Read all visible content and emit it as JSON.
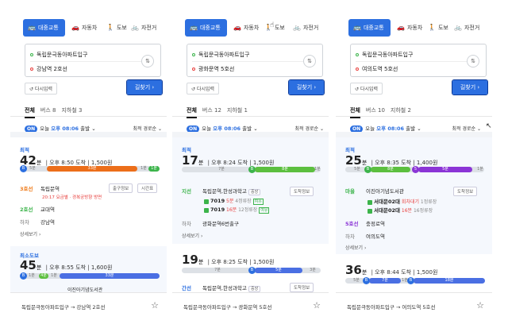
{
  "modes": {
    "transit": "대중교통",
    "car": "자동차",
    "walk": "도보",
    "bike": "자전거"
  },
  "reset_label": "다시입력",
  "go_label": "길찾기",
  "depart": {
    "badge": "ON",
    "prefix": "오늘",
    "time": "오후 08:06",
    "suffix": "출발"
  },
  "sort_label": "최적 경로순",
  "detail_more": "상세보기",
  "panels": [
    {
      "origin": "독립문극동아파트입구",
      "destination": "강남역 2호선",
      "tabs": {
        "all": "전체",
        "bus": "버스 8",
        "subway": "지하철 3"
      },
      "card1": {
        "label": "최적",
        "minutes": "42",
        "unit": "분",
        "arrive": "오후 8:50 도착",
        "fare": "1,500원",
        "bar": {
          "walk1": "5분",
          "bus": "33분",
          "walk2": "1분",
          "dist": "1분"
        },
        "step1_line": "3호선",
        "step1_stop": "독립문역",
        "step1_sub": "20:17 요금별 · 경복궁방향 방면",
        "step1_btn1": "출구정보",
        "step1_btn2": "시간표",
        "step2_line": "2호선",
        "step2_stop": "교대역",
        "step3_line": "하차",
        "step3_stop": "강남역"
      },
      "card2": {
        "label": "최소도보",
        "minutes": "45",
        "unit": "분",
        "arrive": "오후 8:55 도착",
        "fare": "1,600원",
        "bar": {
          "a": "1분",
          "b": "4분",
          "c": "1분",
          "bus": "33분"
        },
        "next_stop": "이진아기념도서관"
      },
      "footer": "독립문극동아파트입구 → 강남역 2호선"
    },
    {
      "origin": "독립문극동아파트입구",
      "destination": "광화문역 5호선",
      "tabs": {
        "all": "전체",
        "bus": "버스 12",
        "subway": "지하철 1"
      },
      "card1": {
        "label": "최적",
        "minutes": "17",
        "unit": "분",
        "arrive": "오후 8:24 도착",
        "fare": "1,500원",
        "bar": {
          "walk1": "7분",
          "bus": "8분",
          "walk2": "1분"
        },
        "step1_line": "지선",
        "step1_stop": "독립문역,한성과학고",
        "step1_tag": "중앙",
        "step1_btn": "도착정보",
        "bus1_no": "7019",
        "bus1_time": "5분",
        "bus1_left": "4정류장",
        "bus1_tag": "여유",
        "bus2_no": "7019",
        "bus2_time": "16분",
        "bus2_left": "12정류장",
        "bus2_tag": "여유",
        "step2_line": "하차",
        "step2_stop": "광화문역6번출구"
      },
      "card2": {
        "minutes": "19",
        "unit": "분",
        "arrive": "오후 8:25 도착",
        "fare": "1,500원",
        "bar": {
          "a": "7분",
          "bus": "5분",
          "b": "3분"
        },
        "next_line": "간선",
        "next_stop": "독립문역,한성과학고",
        "next_tag": "중앙",
        "next_btn": "도착정보",
        "next_bus_time": "3분",
        "next_bus_left": "정류장"
      },
      "footer": "독립문극동아파트입구 → 광화문역 5호선"
    },
    {
      "origin": "독립문극동아파트입구",
      "destination": "여의도역 5호선",
      "tabs": {
        "all": "전체",
        "bus": "버스 10",
        "subway": "지하철 2"
      },
      "card1": {
        "label": "최적",
        "minutes": "25",
        "unit": "분",
        "arrive": "오후 8:35 도착",
        "fare": "1,400원",
        "bar": {
          "walk1": "5분",
          "green": "8분",
          "purple": "5분",
          "walk2": "1분"
        },
        "step1_line": "마을",
        "step1_stop": "이진아기념도서관",
        "step1_btn": "도착정보",
        "bus1_no": "서대문02대",
        "bus1_time": "회차대기",
        "bus1_left": "1정류장",
        "bus2_no": "서대문02대",
        "bus2_time": "16분",
        "bus2_left": "16정류장",
        "step2_line": "5호선",
        "step2_stop": "충정로역",
        "step3_line": "하차",
        "step3_stop": "여의도역"
      },
      "card2": {
        "minutes": "36",
        "unit": "분",
        "arrive": "오후 8:44 도착",
        "fare": "1,500원",
        "bar": {
          "a": "5분",
          "b": "7분",
          "c": "1분",
          "bus": "18분"
        }
      },
      "footer": "독립문극동아파트입구 → 여의도역 5호선"
    }
  ],
  "colors": {
    "accent": "#2c6fe0",
    "bus_orange": "#ec6e1a",
    "bus_green": "#5cbf3f",
    "subway_blue": "#4a6fe3",
    "purple": "#8b35d6",
    "line3": "#ef7c1c"
  }
}
